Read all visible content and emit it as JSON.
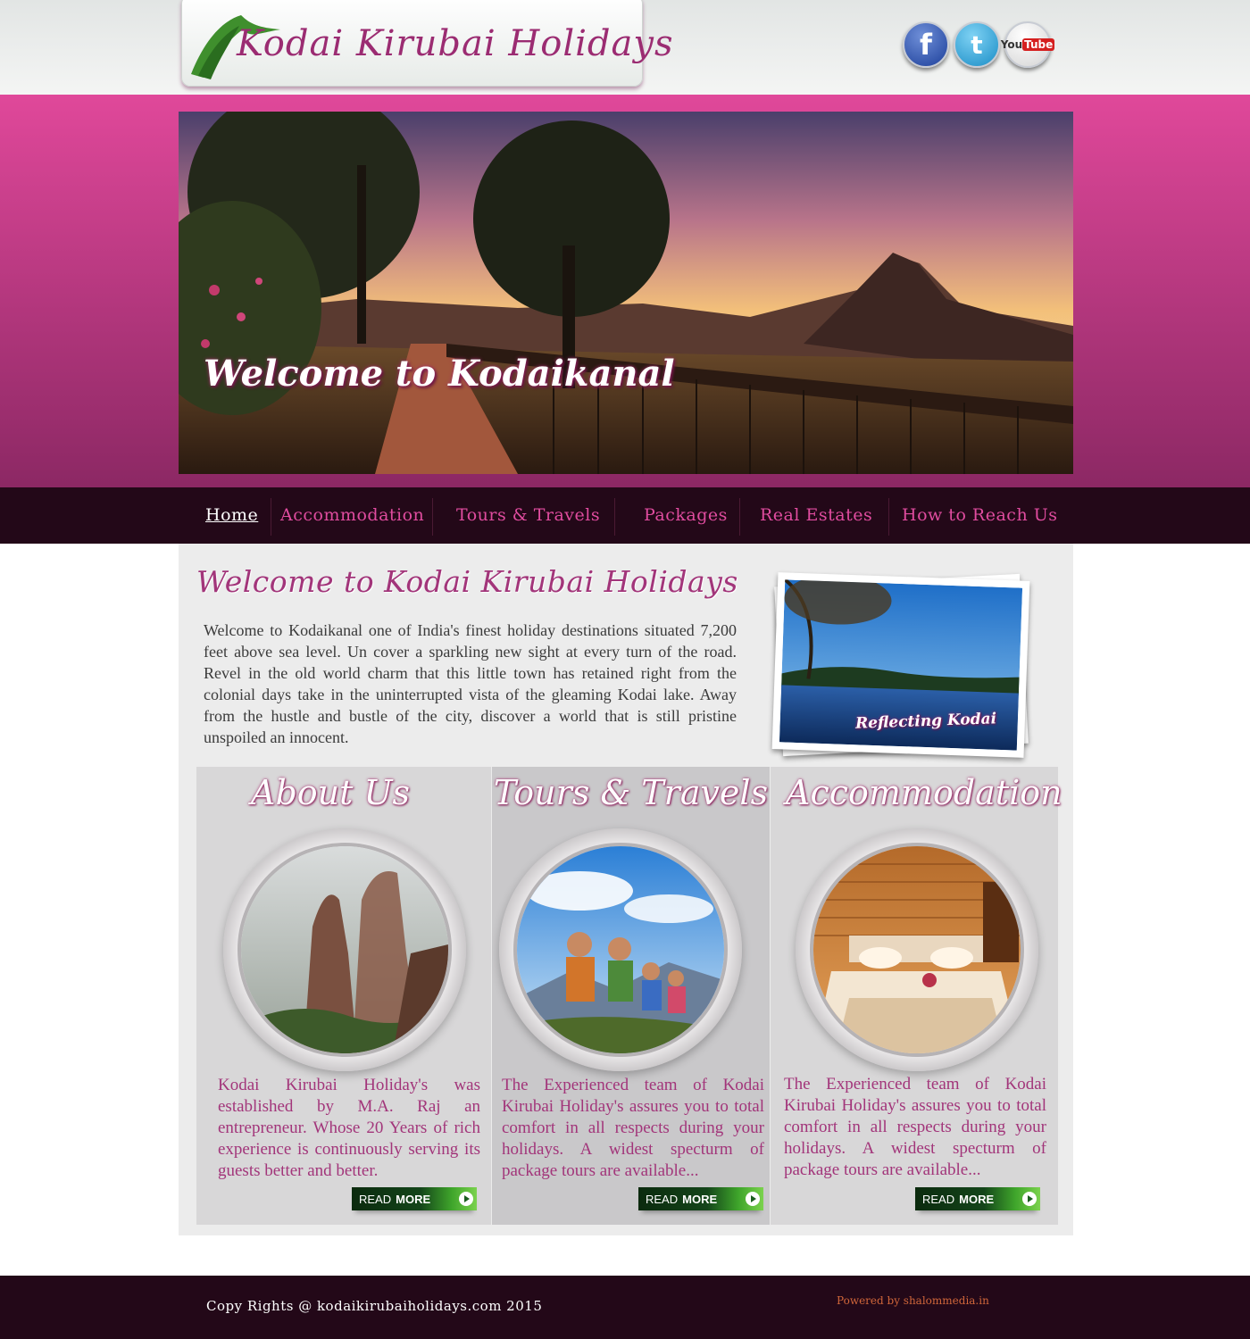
{
  "header": {
    "logo_text": "Kodai Kirubai Holidays",
    "social": {
      "facebook": "f",
      "twitter": "t",
      "youtube_you": "You",
      "youtube_tube": "Tube"
    }
  },
  "banner": {
    "title": "Welcome to Kodaikanal"
  },
  "nav": {
    "items": [
      {
        "label": "Home"
      },
      {
        "label": "Accommodation"
      },
      {
        "label": "Tours & Travels"
      },
      {
        "label": "Packages"
      },
      {
        "label": "Real Estates"
      },
      {
        "label": "How to Reach Us"
      }
    ],
    "active": "Home"
  },
  "welcome": {
    "title": "Welcome to Kodai Kirubai Holidays",
    "text": "Welcome to Kodaikanal one of India's finest holiday destinations situated 7,200 feet above sea level.  Un cover a sparkling new sight at every turn of the road.  Revel  in the old world charm that this little town has retained right from the colonial days take in the uninterrupted vista of the gleaming Kodai lake.  Away from the hustle and bustle of the city, discover a world that is still pristine unspoiled an innocent.",
    "photo_caption": "Reflecting Kodai"
  },
  "columns": [
    {
      "title": "About Us",
      "text": "Kodai Kirubai Holiday's was established by M.A. Raj an entrepreneur. Whose 20 Years of rich experience is continuously serving its guests better and better.",
      "button_read": "READ",
      "button_more": "MORE"
    },
    {
      "title": "Tours & Travels",
      "text": "The Experienced team of Kodai Kirubai Holiday's assures you to total comfort in all respects during your holidays. A widest specturm of package tours are available...",
      "button_read": "READ",
      "button_more": "MORE"
    },
    {
      "title": "Accommodation",
      "text": "The Experienced team of Kodai Kirubai Holiday's assures you to total comfort in all respects during your holidays. A widest specturm of package tours are available...",
      "button_read": "READ",
      "button_more": "MORE"
    }
  ],
  "footer": {
    "copyright": "Copy Rights @ kodaikirubaiholidays.com 2015",
    "powered_by": "Powered by shalommedia.in"
  },
  "colors": {
    "brand_pink": "#e04c9f",
    "brand_magenta": "#a2357a",
    "dark_plum": "#230818",
    "read_more_green": "#3fa52b"
  }
}
